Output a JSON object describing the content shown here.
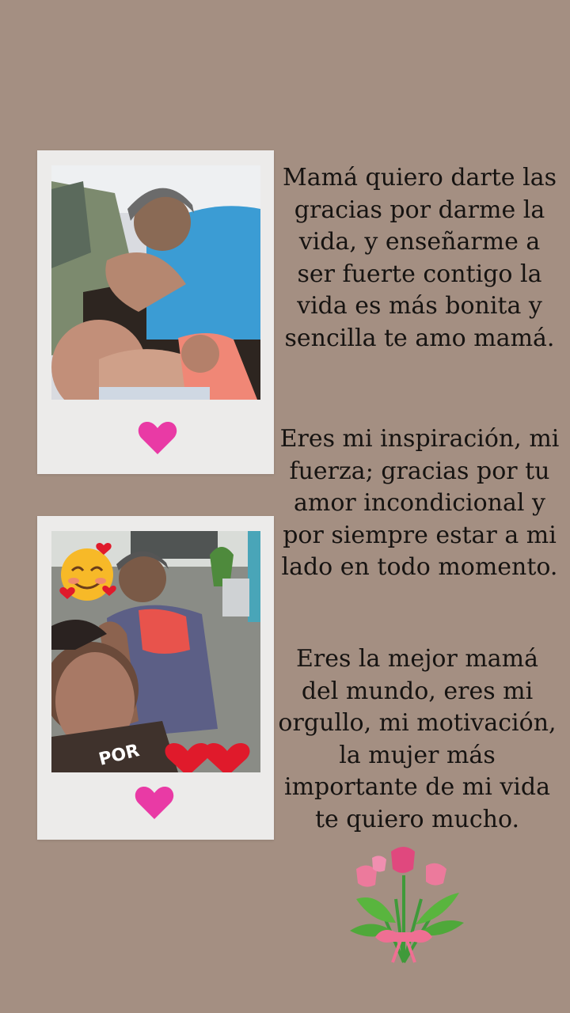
{
  "paragraphs": [
    "Mamá quiero darte las gracias por darme la vida, y enseñarme a ser fuerte contigo la vida es más bonita y sencilla te amo mamá.",
    "Eres mi inspiración, mi fuerza; gracias por tu amor incondicional y por siempre estar a mi lado en todo momento.",
    "Eres la mejor mamá del mundo, eres mi orgullo, mi motivación, la mujer más importante de mi vida te quiero mucho."
  ],
  "sticker_text": "POR",
  "colors": {
    "background": "#a48f82",
    "frame": "#ecebea",
    "heart": "#e93aa5",
    "text": "#161311"
  },
  "icons": [
    "pink-heart-icon",
    "smiling-face-with-hearts-icon",
    "red-heart-icon",
    "tulip-bouquet-icon"
  ]
}
